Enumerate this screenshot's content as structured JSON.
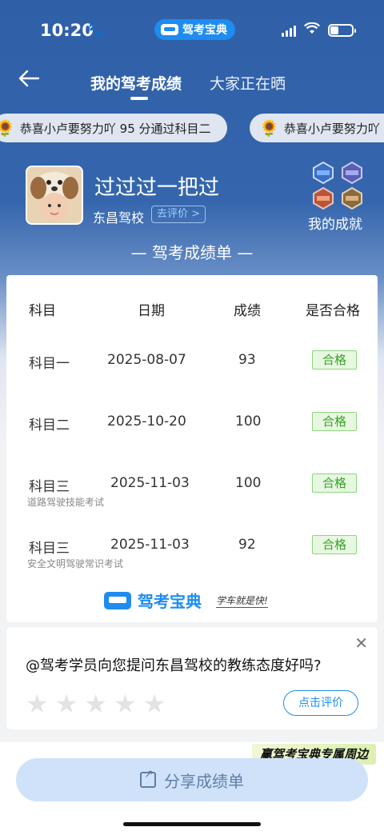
{
  "status_bar": {
    "time": "10:20",
    "app_name": "驾考宝典"
  },
  "nav": {
    "active_tab": "我的驾考成绩",
    "other_tab": "大家正在晒"
  },
  "ticker": [
    {
      "icon": "sunflower-icon",
      "text": "恭喜小卢要努力吖 95 分通过科目二"
    },
    {
      "icon": "sunflower-icon",
      "text": "恭喜小卢要努力吖"
    }
  ],
  "profile": {
    "name": "过过过一把过",
    "school": "东昌驾校",
    "rate_link": "去评价 >",
    "achievements_label": "我的成就"
  },
  "report": {
    "title": "— 驾考成绩单 —",
    "headers": [
      "科目",
      "日期",
      "成绩",
      "是否合格"
    ],
    "rows": [
      {
        "subject": "科目一",
        "date": "2025-08-07",
        "score": "93",
        "result": "合格",
        "note": ""
      },
      {
        "subject": "科目二",
        "date": "2025-10-20",
        "score": "100",
        "result": "合格",
        "note": ""
      },
      {
        "subject": "科目三",
        "date": "2025-11-03",
        "score": "100",
        "result": "合格",
        "note": "道路驾驶技能考试"
      },
      {
        "subject": "科目三",
        "date": "2025-11-03",
        "score": "92",
        "result": "合格",
        "note": "安全文明驾驶常识考试"
      }
    ],
    "brand": "驾考宝典",
    "slogan": "学车就是快!"
  },
  "question": {
    "text": "@驾考学员向您提问东昌驾校的教练态度好吗?",
    "button": "点击评价",
    "star_count": 5
  },
  "promo": "赢驾考宝典专属周边",
  "share_button": "分享成绩单",
  "colors": {
    "primary_blue": "#2f5fa7",
    "brand_blue": "#1e8cf0",
    "pass_green": "#3aa02a"
  }
}
